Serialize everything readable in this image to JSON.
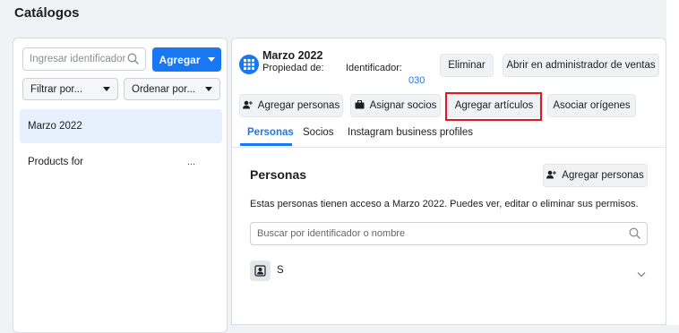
{
  "page": {
    "title": "Catálogos"
  },
  "left": {
    "search_placeholder": "Ingresar identificador o nombre",
    "search_visible": "Ingresar identificador...",
    "add_button": "Agregar",
    "filter_label": "Filtrar por...",
    "sort_label": "Ordenar por...",
    "items": [
      {
        "label": "Marzo 2022",
        "selected": true
      },
      {
        "label": "Products for",
        "trailing": "..."
      }
    ]
  },
  "catalog": {
    "title": "Marzo 2022",
    "owner_label": "Propiedad de:",
    "id_label": "Identificador:",
    "id_value": "030",
    "delete_button": "Eliminar",
    "open_sales_manager_button": "Abrir en administrador de ventas",
    "add_people_button": "Agregar personas",
    "assign_partners_button": "Asignar socios",
    "add_items_button": "Agregar artículos",
    "associate_sources_button": "Asociar orígenes"
  },
  "tabs": [
    {
      "label": "Personas",
      "active": true
    },
    {
      "label": "Socios",
      "active": false
    },
    {
      "label": "Instagram business profiles",
      "active": false
    }
  ],
  "people": {
    "section_title": "Personas",
    "add_people_button": "Agregar personas",
    "description": "Estas personas tienen acceso a Marzo 2022. Puedes ver, editar o eliminar sus permisos.",
    "search_placeholder": "Buscar por identificador o nombre",
    "rows": [
      {
        "name": "S"
      }
    ]
  },
  "colors": {
    "accent": "#1877f2",
    "highlight": "#e4161d",
    "background": "#f0f2f5"
  },
  "icons": [
    "search-icon",
    "caret-down-icon",
    "grid-icon",
    "person-add-icon",
    "briefcase-icon",
    "id-badge-icon",
    "chevron-down-icon"
  ]
}
